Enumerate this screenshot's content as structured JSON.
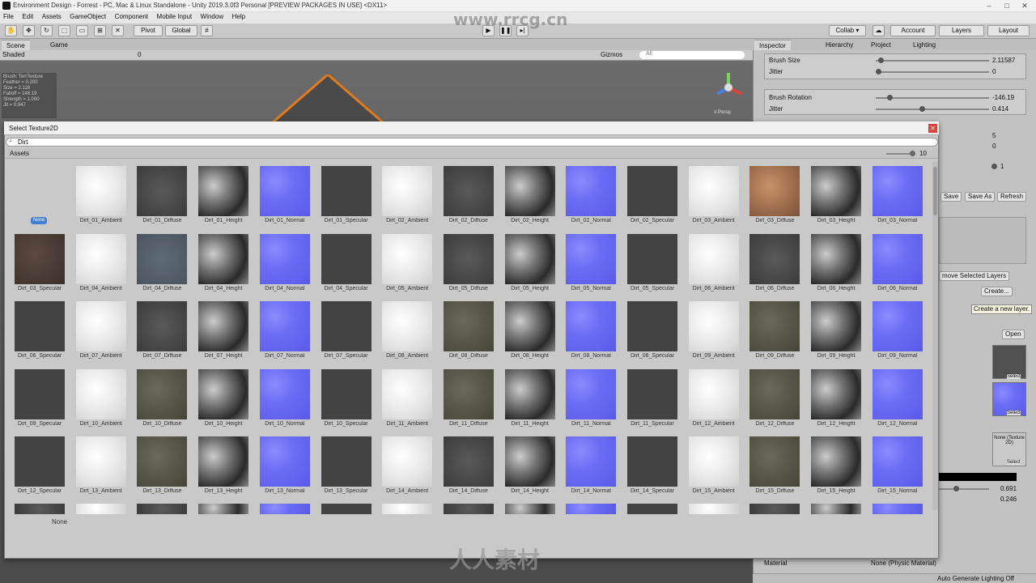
{
  "window": {
    "title": "Environment Design - Forrest - PC, Mac & Linux Standalone - Unity 2019.3.0f3 Personal [PREVIEW PACKAGES IN USE] <DX11>",
    "minimize": "–",
    "maximize": "□",
    "close": "✕"
  },
  "menu": [
    "File",
    "Edit",
    "Assets",
    "GameObject",
    "Component",
    "Mobile Input",
    "Window",
    "Help"
  ],
  "toolbar": {
    "pivot": "Pivot",
    "global": "Global",
    "collab": "Collab ▾",
    "account": "Account",
    "layers": "Layers",
    "layout": "Layout"
  },
  "scene": {
    "tab_scene": "Scene",
    "tab_game": "Game",
    "shading": "Shaded",
    "gizmos": "Gizmos",
    "search_placeholder": "All",
    "layer_count": "0",
    "persp": "≡ Persp",
    "brush_info": [
      "Brush: TerrTexture",
      "",
      "Feather = 0.200",
      "Size = 2.116",
      "Falloff = 148.19",
      "Strength = 1.000",
      "Jit = 0.947"
    ]
  },
  "inspector": {
    "tabs": [
      "Inspector",
      "Hierarchy",
      "Project",
      "Lighting"
    ],
    "brush_size_label": "Brush Size",
    "brush_size_value": "2.11587",
    "brush_size_fraction": 0.02,
    "jitter1_label": "Jitter",
    "jitter1_value": "0",
    "brush_rotation_label": "Brush Rotation",
    "brush_rotation_value": "-146.19",
    "brush_rotation_fraction": 0.1,
    "jitter2_label": "Jitter",
    "jitter2_value": "0.414",
    "value_5": "5",
    "value_0": "0",
    "value_1": "1",
    "save": "Save",
    "save_as": "Save As",
    "refresh": "Refresh",
    "remove_layers": "move Selected Layers",
    "create": "Create...",
    "tooltip": "Create a new layer.",
    "open": "Open",
    "select": "Select",
    "none_texture": "None (Texture 2D)",
    "value_0691": "0.691",
    "value_0246": "0.246",
    "material_label": "Material",
    "material_value": "None (Physic Material)",
    "auto_generate": "Auto Generate Lighting Off"
  },
  "dialog": {
    "title": "Select Texture2D",
    "search": "Dirt",
    "assets_label": "Assets",
    "zoom_count": "10",
    "none_label": "None",
    "none_bottom": "None",
    "close": "✕"
  },
  "textures": [
    {
      "name": "None",
      "kind": "none"
    },
    {
      "name": "Dirt_01_Ambient",
      "kind": "ambient"
    },
    {
      "name": "Dirt_01_Diffuse",
      "kind": "diffuse"
    },
    {
      "name": "Dirt_01_Height",
      "kind": "height"
    },
    {
      "name": "Dirt_01_Normal",
      "kind": "normal"
    },
    {
      "name": "Dirt_01_Specular",
      "kind": "specular"
    },
    {
      "name": "Dirt_02_Ambient",
      "kind": "ambient"
    },
    {
      "name": "Dirt_02_Diffuse",
      "kind": "diffuse"
    },
    {
      "name": "Dirt_02_Height",
      "kind": "height"
    },
    {
      "name": "Dirt_02_Normal",
      "kind": "normal"
    },
    {
      "name": "Dirt_02_Specular",
      "kind": "specular"
    },
    {
      "name": "Dirt_03_Ambient",
      "kind": "ambient"
    },
    {
      "name": "Dirt_03_Diffuse",
      "kind": "diff-brown"
    },
    {
      "name": "Dirt_03_Height",
      "kind": "height"
    },
    {
      "name": "Dirt_03_Normal",
      "kind": "normal"
    },
    {
      "name": "Dirt_03_Specular",
      "kind": "diff-dirt"
    },
    {
      "name": "Dirt_04_Ambient",
      "kind": "ambient"
    },
    {
      "name": "Dirt_04_Diffuse",
      "kind": "diff-blue"
    },
    {
      "name": "Dirt_04_Height",
      "kind": "height"
    },
    {
      "name": "Dirt_04_Normal",
      "kind": "normal"
    },
    {
      "name": "Dirt_04_Specular",
      "kind": "specular"
    },
    {
      "name": "Dirt_05_Ambient",
      "kind": "ambient"
    },
    {
      "name": "Dirt_05_Diffuse",
      "kind": "diffuse"
    },
    {
      "name": "Dirt_05_Height",
      "kind": "height"
    },
    {
      "name": "Dirt_05_Normal",
      "kind": "normal"
    },
    {
      "name": "Dirt_05_Specular",
      "kind": "specular"
    },
    {
      "name": "Dirt_06_Ambient",
      "kind": "ambient"
    },
    {
      "name": "Dirt_06_Diffuse",
      "kind": "diffuse"
    },
    {
      "name": "Dirt_06_Height",
      "kind": "height"
    },
    {
      "name": "Dirt_06_Normal",
      "kind": "normal"
    },
    {
      "name": "Dirt_06_Specular",
      "kind": "specular"
    },
    {
      "name": "Dirt_07_Ambient",
      "kind": "ambient"
    },
    {
      "name": "Dirt_07_Diffuse",
      "kind": "diffuse"
    },
    {
      "name": "Dirt_07_Height",
      "kind": "height"
    },
    {
      "name": "Dirt_07_Normal",
      "kind": "normal"
    },
    {
      "name": "Dirt_07_Specular",
      "kind": "specular"
    },
    {
      "name": "Dirt_08_Ambient",
      "kind": "ambient"
    },
    {
      "name": "Dirt_08_Diffuse",
      "kind": "diff-rough"
    },
    {
      "name": "Dirt_08_Height",
      "kind": "height"
    },
    {
      "name": "Dirt_08_Normal",
      "kind": "normal"
    },
    {
      "name": "Dirt_08_Specular",
      "kind": "specular"
    },
    {
      "name": "Dirt_09_Ambient",
      "kind": "ambient"
    },
    {
      "name": "Dirt_09_Diffuse",
      "kind": "diff-rough"
    },
    {
      "name": "Dirt_09_Height",
      "kind": "height"
    },
    {
      "name": "Dirt_09_Normal",
      "kind": "normal"
    },
    {
      "name": "Dirt_09_Specular",
      "kind": "specular"
    },
    {
      "name": "Dirt_10_Ambient",
      "kind": "ambient"
    },
    {
      "name": "Dirt_10_Diffuse",
      "kind": "diff-rough"
    },
    {
      "name": "Dirt_10_Height",
      "kind": "height"
    },
    {
      "name": "Dirt_10_Normal",
      "kind": "normal"
    },
    {
      "name": "Dirt_10_Specular",
      "kind": "specular"
    },
    {
      "name": "Dirt_11_Ambient",
      "kind": "ambient"
    },
    {
      "name": "Dirt_11_Diffuse",
      "kind": "diff-rough"
    },
    {
      "name": "Dirt_11_Height",
      "kind": "height"
    },
    {
      "name": "Dirt_11_Normal",
      "kind": "normal"
    },
    {
      "name": "Dirt_11_Specular",
      "kind": "specular"
    },
    {
      "name": "Dirt_12_Ambient",
      "kind": "ambient"
    },
    {
      "name": "Dirt_12_Diffuse",
      "kind": "diff-rough"
    },
    {
      "name": "Dirt_12_Height",
      "kind": "height"
    },
    {
      "name": "Dirt_12_Normal",
      "kind": "normal"
    },
    {
      "name": "Dirt_12_Specular",
      "kind": "specular"
    },
    {
      "name": "Dirt_13_Ambient",
      "kind": "ambient"
    },
    {
      "name": "Dirt_13_Diffuse",
      "kind": "diff-rough"
    },
    {
      "name": "Dirt_13_Height",
      "kind": "height"
    },
    {
      "name": "Dirt_13_Normal",
      "kind": "normal"
    },
    {
      "name": "Dirt_13_Specular",
      "kind": "specular"
    },
    {
      "name": "Dirt_14_Ambient",
      "kind": "ambient"
    },
    {
      "name": "Dirt_14_Diffuse",
      "kind": "diffuse"
    },
    {
      "name": "Dirt_14_Height",
      "kind": "height"
    },
    {
      "name": "Dirt_14_Normal",
      "kind": "normal"
    },
    {
      "name": "Dirt_14_Specular",
      "kind": "specular"
    },
    {
      "name": "Dirt_15_Ambient",
      "kind": "ambient"
    },
    {
      "name": "Dirt_15_Diffuse",
      "kind": "diff-rough"
    },
    {
      "name": "Dirt_15_Height",
      "kind": "height"
    },
    {
      "name": "Dirt_15_Normal",
      "kind": "normal"
    }
  ],
  "watermark": "www.rrcg.cn",
  "watermark2": "人人素材"
}
